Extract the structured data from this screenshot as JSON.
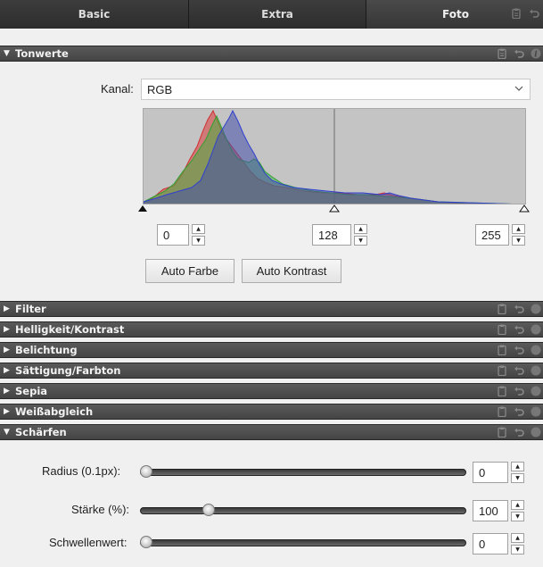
{
  "tabs": [
    {
      "label": "Basic"
    },
    {
      "label": "Extra"
    },
    {
      "label": "Foto"
    }
  ],
  "tonwerte": {
    "title": "Tonwerte",
    "expanded": true,
    "kanal_label": "Kanal:",
    "kanal_value": "RGB",
    "input_low": "0",
    "input_mid": "128",
    "input_high": "255",
    "auto_farbe": "Auto Farbe",
    "auto_kontrast": "Auto Kontrast"
  },
  "sections": [
    {
      "title": "Filter",
      "expanded": false
    },
    {
      "title": "Helligkeit/Kontrast",
      "expanded": false
    },
    {
      "title": "Belichtung",
      "expanded": false
    },
    {
      "title": "Sättigung/Farbton",
      "expanded": false
    },
    {
      "title": "Sepia",
      "expanded": false
    },
    {
      "title": "Weißabgleich",
      "expanded": false
    }
  ],
  "schaerfen": {
    "title": "Schärfen",
    "expanded": true,
    "radius_label": "Radius (0.1px):",
    "radius_value": "0",
    "staerke_label": "Stärke (%):",
    "staerke_value": "100",
    "schwelle_label": "Schwellenwert:",
    "schwelle_value": "0"
  },
  "icons": {
    "expanded_arrow": "▼",
    "collapsed_arrow": "▶",
    "clipboard": "clipboard-icon",
    "undo": "undo-icon",
    "info": "info-icon",
    "spin_up": "▲",
    "spin_down": "▼",
    "chevron": "﹀"
  },
  "colors": {
    "header_bg": "#4a4a4a",
    "panel_bg": "#f0f0f0",
    "histogram_bg": "#c4c4c4"
  }
}
